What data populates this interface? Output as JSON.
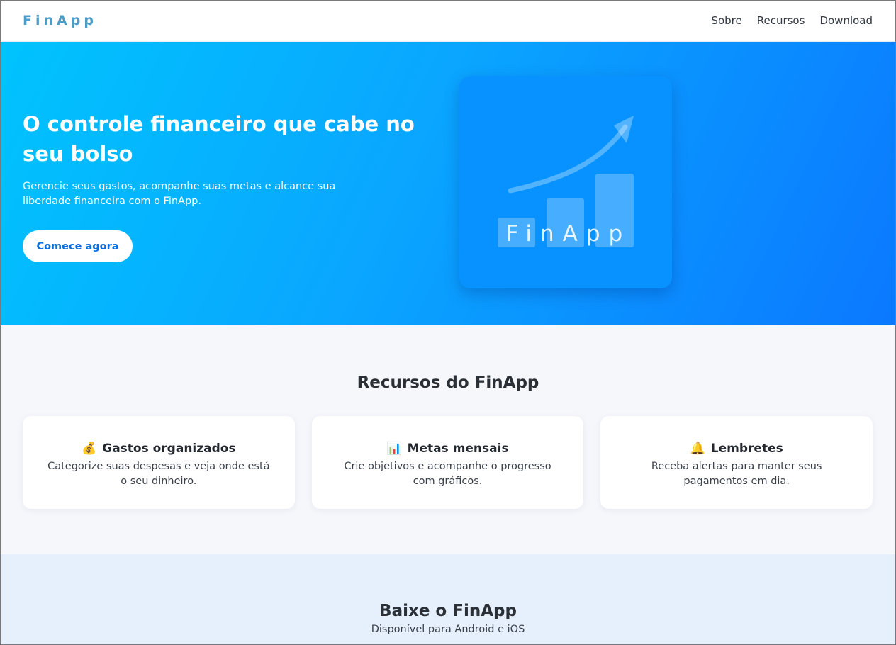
{
  "header": {
    "brand": "FinApp",
    "nav": [
      "Sobre",
      "Recursos",
      "Download"
    ]
  },
  "hero": {
    "title": "O controle financeiro que cabe no seu bolso",
    "subtitle": "Gerencie seus gastos, acompanhe suas metas e alcance sua liberdade financeira com o FinApp.",
    "cta_label": "Comece agora",
    "illustration_text": "FinApp",
    "illustration_icons": [
      "bar-chart-icon",
      "trend-arrow-icon"
    ]
  },
  "features": {
    "title": "Recursos do FinApp",
    "items": [
      {
        "icon": "money-bag-icon",
        "emoji": "💰",
        "title": "Gastos organizados",
        "text": "Categorize suas despesas e veja onde está o seu dinheiro."
      },
      {
        "icon": "bar-chart-icon",
        "emoji": "📊",
        "title": "Metas mensais",
        "text": "Crie objetivos e acompanhe o progresso com gráficos."
      },
      {
        "icon": "bell-icon",
        "emoji": "🔔",
        "title": "Lembretes",
        "text": "Receba alertas para manter seus pagamentos em dia."
      }
    ]
  },
  "download": {
    "title": "Baixe o FinApp",
    "subtitle": "Disponível para Android e iOS"
  },
  "colors": {
    "brand": "#4e9dc7",
    "hero_gradient_start": "#00c3fd",
    "hero_gradient_end": "#0b78ff",
    "cta_text": "#0a6fe0",
    "features_bg": "#f6f7fb",
    "download_bg": "#e6f0fc"
  }
}
